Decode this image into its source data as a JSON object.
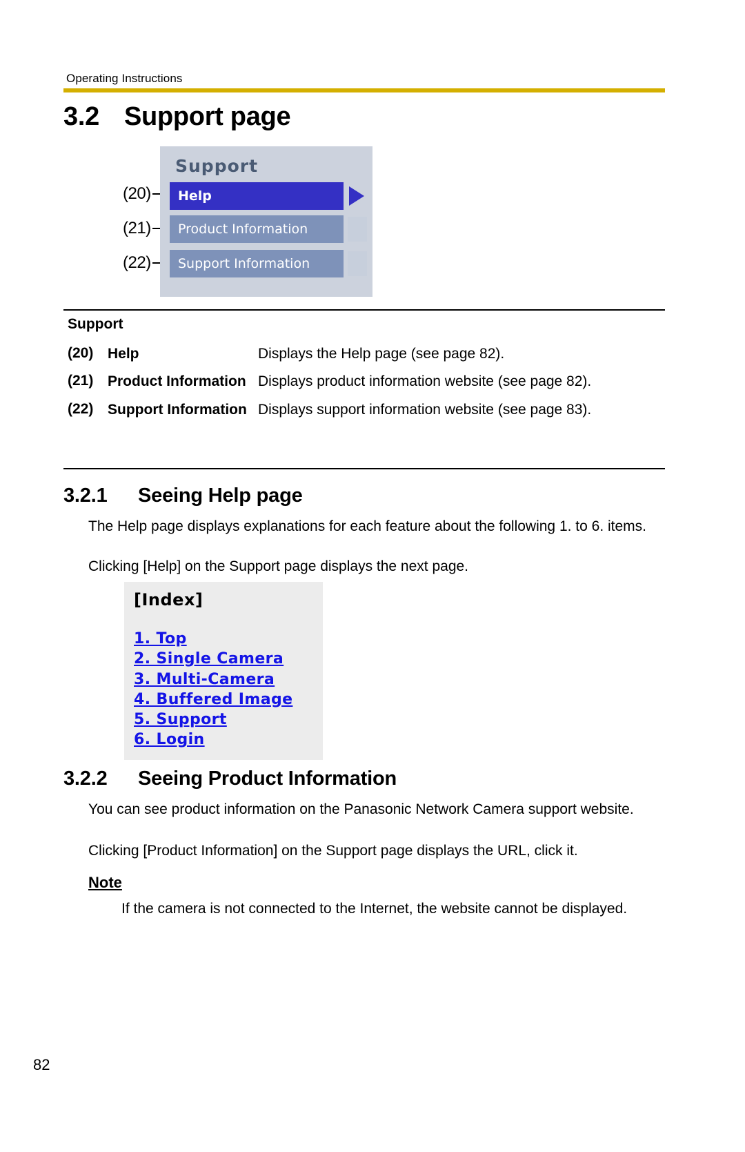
{
  "header": {
    "running_title": "Operating Instructions",
    "rule_color": "#d4af00"
  },
  "chapter": {
    "number": "3.2",
    "title": "Support page"
  },
  "support_figure": {
    "panel_title": "Support",
    "callouts": [
      "(20)",
      "(21)",
      "(22)"
    ],
    "menu_items": [
      {
        "label": "Help",
        "state": "selected",
        "bg": "#3430c4"
      },
      {
        "label": "Product Information",
        "state": "normal",
        "bg": "#7e92b9"
      },
      {
        "label": "Support Information",
        "state": "normal",
        "bg": "#7e92b9"
      }
    ],
    "panel_bg": "#ccd2dd",
    "title_color": "#4a5b74"
  },
  "legend": {
    "title": "Support",
    "rows": [
      {
        "num": "(20)",
        "label": "Help",
        "desc": "Displays the Help page (see page 82)."
      },
      {
        "num": "(21)",
        "label": "Product Information",
        "desc": "Displays product information website (see page 82)."
      },
      {
        "num": "(22)",
        "label": "Support Information",
        "desc": "Displays support information website (see page 83)."
      }
    ]
  },
  "section_321": {
    "number": "3.2.1",
    "title": "Seeing Help page",
    "para1": "The Help page displays explanations for each feature about the following 1. to 6. items.",
    "para2": "Clicking [Help] on the Support page displays the next page."
  },
  "index_figure": {
    "title": "[Index]",
    "links": [
      "1. Top",
      "2. Single Camera",
      "3. Multi-Camera",
      "4. Buffered Image",
      "5. Support",
      "6. Login"
    ],
    "bg": "#ececec",
    "link_color": "#1414e6"
  },
  "section_322": {
    "number": "3.2.2",
    "title": "Seeing Product Information",
    "para1": "You can see product information on the Panasonic Network Camera support website.",
    "para2": "Clicking [Product Information] on the Support page displays the URL, click it."
  },
  "note": {
    "title": "Note",
    "body": "If the camera is not connected to the Internet, the website cannot be displayed."
  },
  "footer": {
    "page_number": "82"
  }
}
